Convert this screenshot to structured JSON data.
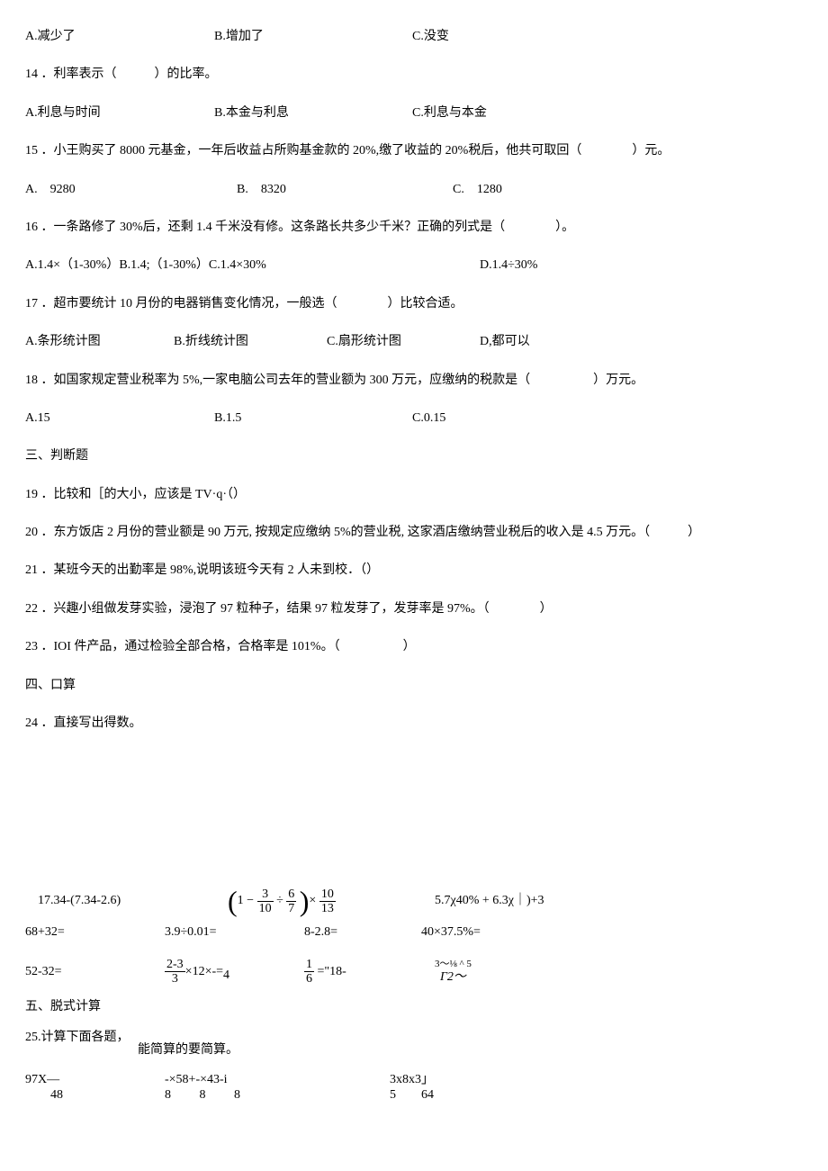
{
  "q13_options": {
    "a": "A.减少了",
    "b": "B.增加了",
    "c": "C.没变"
  },
  "q14": {
    "number": "14",
    "text": "．利率表示（　　　）的比率。",
    "a": "A.利息与时间",
    "b": "B.本金与利息",
    "c": "C.利息与本金"
  },
  "q15": {
    "number": "15",
    "text": "．小王购买了 8000 元基金，一年后收益占所购基金款的 20%,缴了收益的 20%税后，他共可取回（　　　　）元。",
    "a": "A.　9280",
    "b": "B.　8320",
    "c": "C.　1280"
  },
  "q16": {
    "number": "16",
    "text": "．一条路修了 30%后，还剩 1.4 千米没有修。这条路长共多少千米？正确的列式是（　　　　）。",
    "a": "A.1.4×（1-30%）B.1.4;（1-30%）C.1.4×30%",
    "d": "D.1.4÷30%"
  },
  "q17": {
    "number": "17",
    "text": "．超市要统计 10 月份的电器销售变化情况，一般选（　　　　）比较合适。",
    "a": "A.条形统计图",
    "b": "B.折线统计图",
    "c": "C.扇形统计图",
    "d": "D,都可以"
  },
  "q18": {
    "number": "18",
    "text": "．如国家规定营业税率为 5%,一家电脑公司去年的营业额为 300 万元，应缴纳的税款是（　　　　　）万元。",
    "a": "A.15",
    "b": "B.1.5",
    "c": "C.0.15"
  },
  "section3": "三、判断题",
  "q19": {
    "number": "19",
    "text": "．比较和［的大小，应该是 TV·q·（）"
  },
  "q20": {
    "number": "20",
    "text": "．东方饭店 2 月份的营业额是 90 万元, 按规定应缴纳 5%的营业税, 这家酒店缴纳营业税后的收入是 4.5 万元。（　　　）"
  },
  "q21": {
    "number": "21",
    "text": "．某班今天的出勤率是 98%,说明该班今天有 2 人未到校．（）"
  },
  "q22": {
    "number": "22",
    "text": "．兴趣小组做发芽实验，浸泡了 97 粒种子，结果 97 粒发芽了，发芽率是 97%。（　　　　）"
  },
  "q23": {
    "number": "23",
    "text": "．IOI 件产品，通过检验全部合格，合格率是 101%。（　　　　　）"
  },
  "section4": "四、口算",
  "q24": {
    "number": "24",
    "text": "．直接写出得数。"
  },
  "formula_row": {
    "f1": "17.34-(7.34-2.6)",
    "f2_frac1_num": "3",
    "f2_frac1_den": "10",
    "f2_frac2_num": "6",
    "f2_frac2_den": "7",
    "f2_frac3_num": "10",
    "f2_frac3_den": "13",
    "f3": "5.7χ40% + 6.3χ｜)+3"
  },
  "calc_row1": {
    "c1": "68+32=",
    "c2": "3.9÷0.01=",
    "c3": "8-2.8=",
    "c4": "40×37.5%="
  },
  "calc_row2": {
    "c1": "52-32=",
    "c2_top": "2-3",
    "c2_bot": "3",
    "c2_mid": "×12×-=",
    "c2_end": "4",
    "c3_top": "1",
    "c3_bot": "6",
    "c3_eq": "=\"18-",
    "c4_top": "3～⅛ ^ 5",
    "c4_bot": "Γ2～"
  },
  "section5": "五、脱式计算",
  "q25": {
    "number": "25.",
    "text": "计算下面各题，",
    "sub": "能简算的要简算。"
  },
  "final_row": {
    "c1_top": "97X—",
    "c1_bot": "48",
    "c2_top": "-×58+-×43-i",
    "c2_bot": "8　　 8　　 8",
    "c3_top": "3x8x3」",
    "c3_bot": "5　　64"
  }
}
